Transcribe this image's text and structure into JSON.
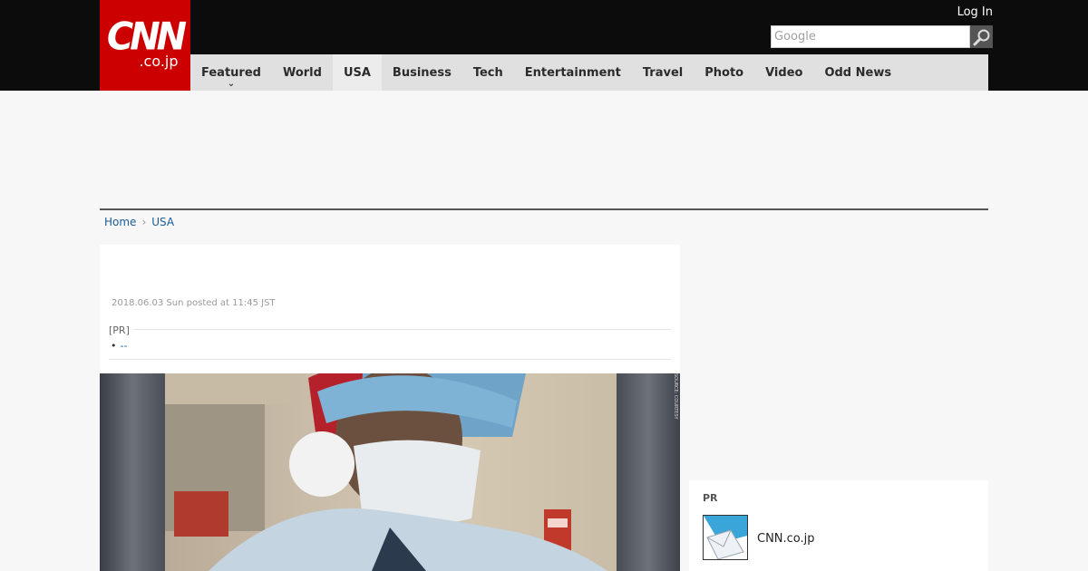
{
  "logo": {
    "main": "CNN",
    "sub": ".co.jp"
  },
  "header": {
    "login_label": "Log In",
    "search_placeholder": "Google"
  },
  "nav": {
    "items": [
      {
        "label": "Featured"
      },
      {
        "label": "World"
      },
      {
        "label": "USA"
      },
      {
        "label": "Business"
      },
      {
        "label": "Tech"
      },
      {
        "label": "Entertainment"
      },
      {
        "label": "Travel"
      },
      {
        "label": "Photo"
      },
      {
        "label": "Video"
      },
      {
        "label": "Odd News"
      }
    ],
    "active": "USA"
  },
  "breadcrumb": {
    "home": "Home",
    "current": "USA"
  },
  "article": {
    "posted": "2018.06.03 Sun posted at 11:45 JST",
    "pr_label": "[PR]",
    "pr_link": "--",
    "photo_credit": "SOURCE: COURTESY"
  },
  "sidebar": {
    "pr_title": "PR",
    "pr_item_name": "CNN.co.jp"
  },
  "colors": {
    "brand_red": "#cc0000",
    "topbar": "#0c0c0c",
    "nav_bg": "#e0e0e0",
    "link": "#1a5c96"
  }
}
